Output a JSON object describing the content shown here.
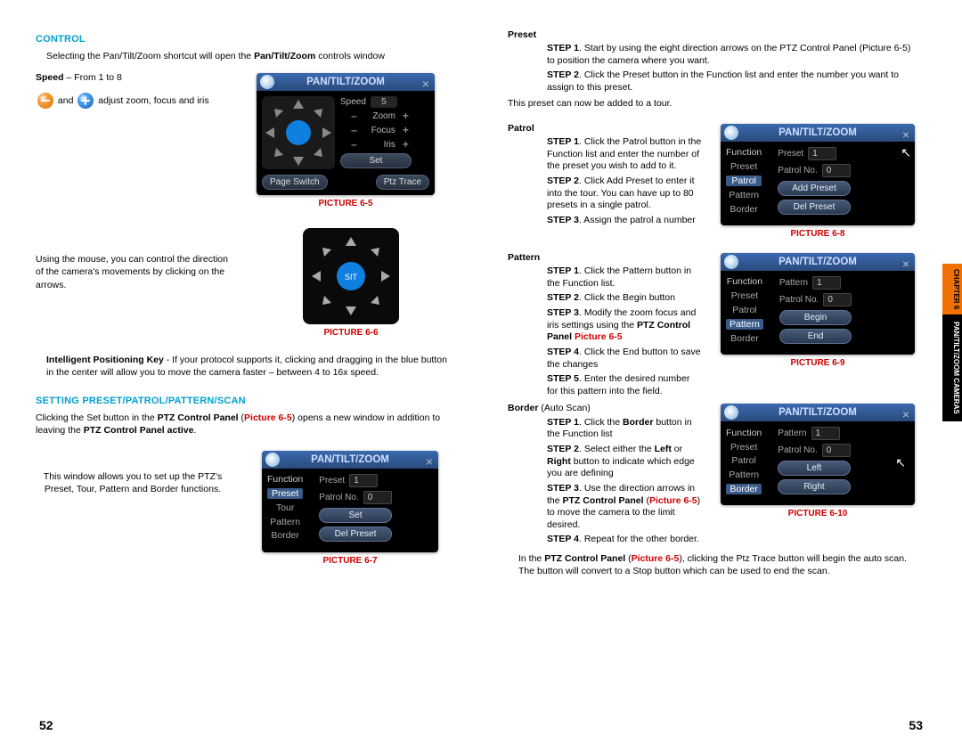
{
  "left": {
    "h_control": "Control",
    "p_sel1": "Selecting the Pan/Tilt/Zoom shortcut will open the ",
    "p_sel2": "Pan/Tilt/Zoom",
    "p_sel3": " controls window",
    "speed_lbl": "Speed",
    "speed_txt": " – From 1 to 8",
    "and": "and",
    "adjust": "adjust zoom, focus and iris",
    "pic65": "PICTURE 6-5",
    "mouse_p": "Using the mouse, you can control the direction of the camera's movements by clicking on the arrows.",
    "pic66": "PICTURE 6-6",
    "ipk_b": "Intelligent Positioning Key",
    "ipk_t": " - If your protocol supports it, clicking and dragging in the blue button in the center will allow you to move the camera faster – between 4 to 16x speed.",
    "h_setting": "Setting Preset/Patrol/Pattern/Scan",
    "set_p1": "Clicking the Set button in the ",
    "set_p2": "PTZ Control Panel",
    "set_p3": " (",
    "set_p4": "Picture 6-5",
    "set_p5": ") opens a new window in addition to leaving the ",
    "set_p6": "PTZ Control Panel active",
    "set_p7": ".",
    "window_p": "This window allows you to set up the PTZ's Preset, Tour, Pattern and Border functions.",
    "pic67": "PICTURE 6-7",
    "page_num": "52"
  },
  "right": {
    "h_preset": "Preset",
    "preset_s1a": "STEP 1",
    "preset_s1b": ". Start by using the eight direction arrows on the PTZ Control Panel (Picture 6-5) to position the camera where you want.",
    "preset_s2a": "STEP 2",
    "preset_s2b": ". Click the Preset button in the Function list and enter the number you want to assign to this preset.",
    "preset_note": "This preset can now be added to a tour.",
    "h_patrol": "Patrol",
    "patrol_s1a": "STEP 1",
    "patrol_s1b": ". Click the Patrol button in the Function list and enter the number of the preset you wish to add to it.",
    "patrol_s2a": "STEP 2",
    "patrol_s2b": ". Click Add Preset to enter it into the tour. You can have up to 80 presets in a single patrol.",
    "patrol_s3a": "STEP 3",
    "patrol_s3b": ". Assign the patrol a number",
    "pic68": "PICTURE 6-8",
    "h_pattern": "Pattern",
    "pattern_s1a": "STEP 1",
    "pattern_s1b": ". Click the Pattern button in the Function list.",
    "pattern_s2a": "STEP 2",
    "pattern_s2b": ". Click the Begin button",
    "pattern_s3a": "STEP 3",
    "pattern_s3b": ". Modify the zoom focus and iris settings using the ",
    "pattern_s3c": "PTZ Control Panel ",
    "pattern_s3d": "Picture 6-5",
    "pattern_s4a": "STEP 4",
    "pattern_s4b": ". Click the End button to save the changes",
    "pattern_s5a": "STEP 5",
    "pattern_s5b": ". Enter the desired number for this pattern into the field.",
    "pic69": "PICTURE 6-9",
    "h_border": "Border",
    "h_border2": " (Auto Scan)",
    "border_s1a": "STEP 1",
    "border_s1b": ". Click the ",
    "border_s1c": "Border",
    "border_s1d": " button in the Function list",
    "border_s2a": "STEP 2",
    "border_s2b": ". Select either the ",
    "border_s2c": "Left",
    "border_s2d": " or ",
    "border_s2e": "Right",
    "border_s2f": " button to indicate which edge you are defining",
    "border_s3a": "STEP 3",
    "border_s3b": ". Use the direction arrows in the ",
    "border_s3c": "PTZ Control Panel",
    "border_s3d": " (",
    "border_s3e": "Picture 6-5",
    "border_s3f": ") to move the camera to the limit desired.",
    "border_s4a": "STEP 4",
    "border_s4b": ". Repeat for the other border.",
    "pic610": "PICTURE 6-10",
    "foot_p1": "In the ",
    "foot_p2": "PTZ Control Panel",
    "foot_p3": " (",
    "foot_p4": "Picture 6-5",
    "foot_p5": "), clicking the Ptz Trace button will begin the auto scan. The button will convert to a Stop button which can be used to end the scan.",
    "page_num": "53"
  },
  "ptz65": {
    "title": "PAN/TILT/ZOOM",
    "speed": "Speed",
    "speed_v": "5",
    "zoom": "Zoom",
    "focus": "Focus",
    "iris": "Iris",
    "set": "Set",
    "trace": "Ptz Trace",
    "page": "Page Switch"
  },
  "ptz67": {
    "title": "PAN/TILT/ZOOM",
    "function": "Function",
    "preset": "Preset",
    "tour": "Tour",
    "pattern": "Pattern",
    "border": "Border",
    "preset_lbl": "Preset",
    "preset_v": "1",
    "patrol_lbl": "Patrol No.",
    "patrol_v": "0",
    "btn_set": "Set",
    "btn_del": "Del Preset"
  },
  "ptz68": {
    "title": "PAN/TILT/ZOOM",
    "function": "Function",
    "preset": "Preset",
    "patrol": "Patrol",
    "pattern": "Pattern",
    "border": "Border",
    "preset_lbl": "Preset",
    "preset_v": "1",
    "patrol_lbl": "Patrol No.",
    "patrol_v": "0",
    "btn_add": "Add Preset",
    "btn_del": "Del Preset"
  },
  "ptz69": {
    "title": "PAN/TILT/ZOOM",
    "function": "Function",
    "preset": "Preset",
    "patrol": "Patrol",
    "pattern": "Pattern",
    "border": "Border",
    "preset_lbl": "Pattern",
    "preset_v": "1",
    "patrol_lbl": "Patrol No.",
    "patrol_v": "0",
    "btn_begin": "Begin",
    "btn_end": "End"
  },
  "ptz610": {
    "title": "PAN/TILT/ZOOM",
    "function": "Function",
    "preset": "Preset",
    "patrol": "Patrol",
    "pattern": "Pattern",
    "border": "Border",
    "preset_lbl": "Pattern",
    "preset_v": "1",
    "patrol_lbl": "Patrol No.",
    "patrol_v": "0",
    "btn_left": "Left",
    "btn_right": "Right"
  },
  "tab": {
    "chapter": "CHAPTER 6",
    "label": "PAN/TILT/ZOOM CAMERAS"
  },
  "sit": "SIT"
}
